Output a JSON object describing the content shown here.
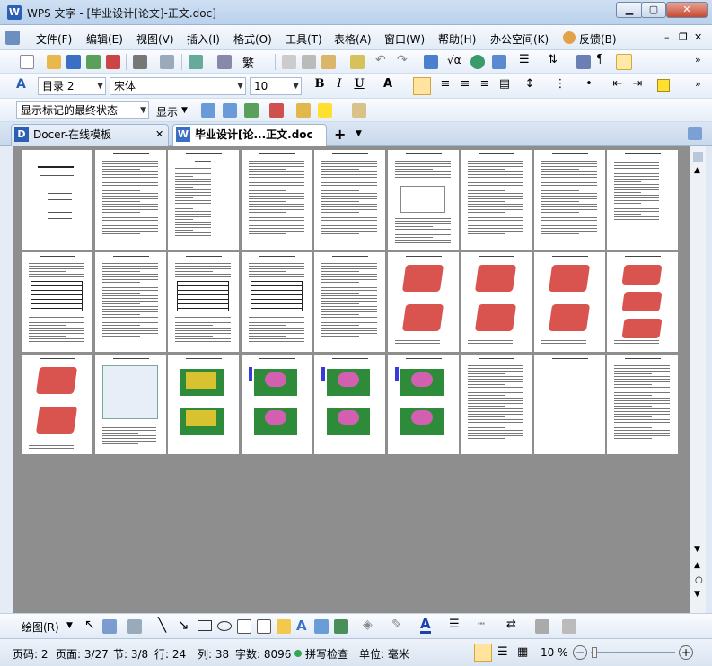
{
  "window": {
    "app_icon": "W",
    "title": "WPS 文字 - [毕业设计[论文]-正文.doc]"
  },
  "menu": [
    "文件(F)",
    "编辑(E)",
    "视图(V)",
    "插入(I)",
    "格式(O)",
    "工具(T)",
    "表格(A)",
    "窗口(W)",
    "帮助(H)",
    "办公空间(K)",
    "反馈(B)"
  ],
  "format_bar": {
    "style": "目录 2",
    "font": "宋体",
    "size": "10",
    "bold": "B",
    "italic": "I",
    "underline": "U",
    "font_color_label": "A"
  },
  "revision_bar": {
    "mode": "显示标记的最终状态",
    "show": "显示"
  },
  "tabs": [
    {
      "label": "Docer-在线模板",
      "icon": "D"
    },
    {
      "label": "毕业设计[论...正文.doc",
      "icon": "W"
    }
  ],
  "new_tab": "+",
  "draw_bar": {
    "label": "绘图(R)"
  },
  "status": {
    "page_code": "页码: 2",
    "page": "页面: 3/27",
    "section": "节: 3/8",
    "row": "行: 24",
    "col": "列: 38",
    "word_count": "字数: 8096",
    "spell": "拼写检查",
    "unit": "单位: 毫米",
    "zoom": "10 %"
  },
  "pages_count": 27,
  "colors": {
    "accent": "#2b5fb4",
    "model_red": "#d9534f",
    "model_green": "#2e8b3a",
    "model_yellow": "#d8c230"
  }
}
